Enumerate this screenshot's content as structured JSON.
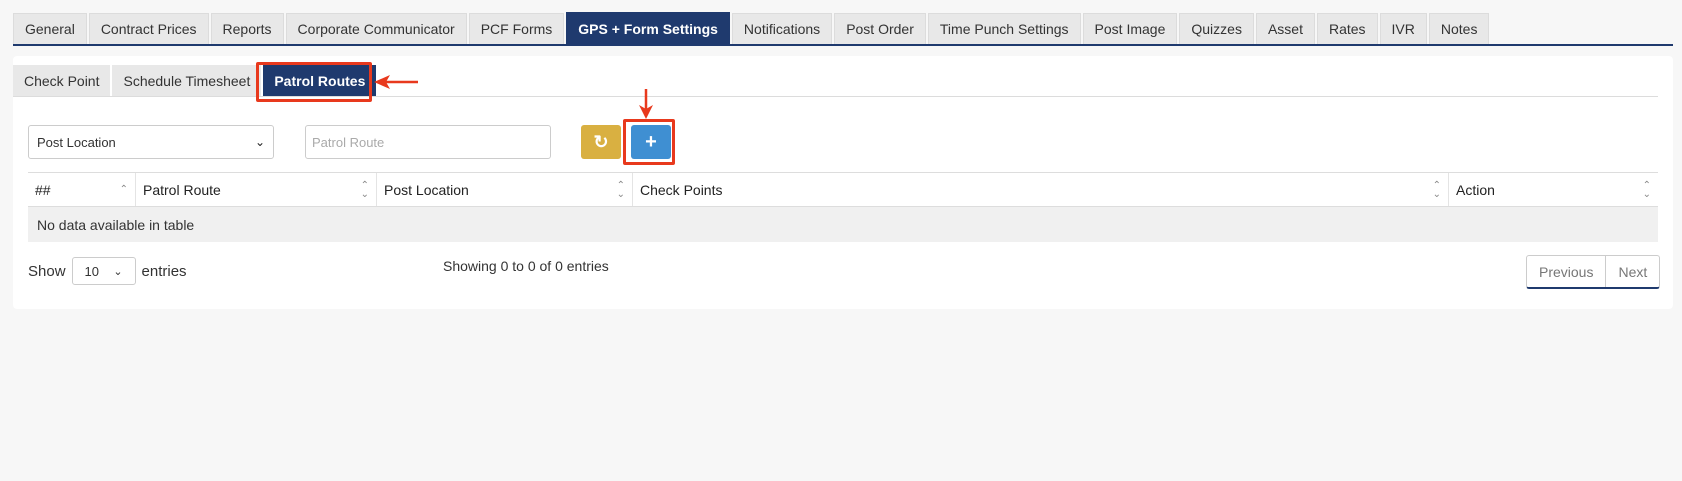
{
  "top_tabs": [
    {
      "label": "General"
    },
    {
      "label": "Contract Prices"
    },
    {
      "label": "Reports"
    },
    {
      "label": "Corporate Communicator"
    },
    {
      "label": "PCF Forms"
    },
    {
      "label": "GPS + Form Settings",
      "active": true
    },
    {
      "label": "Notifications"
    },
    {
      "label": "Post Order"
    },
    {
      "label": "Time Punch Settings"
    },
    {
      "label": "Post Image"
    },
    {
      "label": "Quizzes"
    },
    {
      "label": "Asset"
    },
    {
      "label": "Rates"
    },
    {
      "label": "IVR"
    },
    {
      "label": "Notes"
    }
  ],
  "sub_tabs": [
    {
      "label": "Check Point"
    },
    {
      "label": "Schedule Timesheet"
    },
    {
      "label": "Patrol Routes",
      "active": true
    }
  ],
  "filters": {
    "post_location_value": "Post Location",
    "patrol_route_placeholder": "Patrol Route"
  },
  "buttons": {
    "refresh_icon": "refresh-icon",
    "add_icon": "plus-icon"
  },
  "table": {
    "columns": [
      "##",
      "Patrol Route",
      "Post Location",
      "Check Points",
      "Action"
    ],
    "empty_message": "No data available in table"
  },
  "footer": {
    "show_label": "Show",
    "entries_value": "10",
    "entries_label": "entries",
    "info": "Showing 0 to 0 of 0 entries",
    "previous": "Previous",
    "next": "Next"
  },
  "colors": {
    "active_tab": "#1f3a6e",
    "refresh_button": "#d9b041",
    "add_button": "#3f8fd2",
    "annotation": "#e8391d"
  }
}
